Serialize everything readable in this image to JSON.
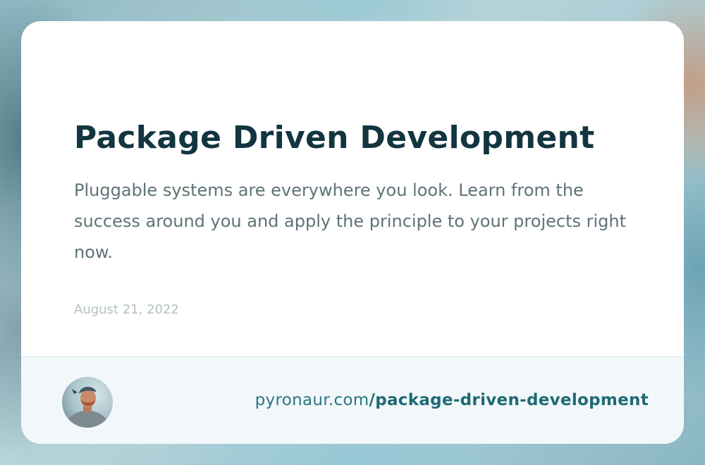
{
  "post": {
    "title": "Package Driven Development",
    "description": "Pluggable systems are everywhere you look. Learn from the success around you and apply the principle to your projects right now.",
    "date": "August 21, 2022"
  },
  "footer": {
    "domain": "pyronaur.com",
    "path": "/package-driven-development"
  },
  "colors": {
    "title": "#123540",
    "description": "#5e7378",
    "date": "#b3c0c3",
    "link": "#2b7580",
    "footer_bg": "#f2f8f9"
  }
}
